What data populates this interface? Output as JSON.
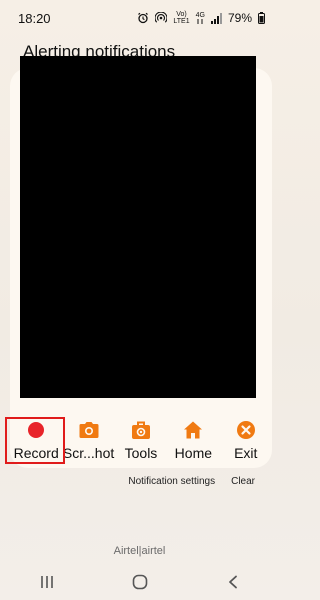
{
  "status_bar": {
    "time": "18:20",
    "network_label_top": "Vo)",
    "network_label_mid": "LTE1",
    "network_type": "4G",
    "battery": "79%"
  },
  "heading": "Alerting notifications",
  "actions": [
    {
      "label": "Record",
      "icon": "record-dot-icon"
    },
    {
      "label": "Scr...hot",
      "icon": "camera-icon"
    },
    {
      "label": "Tools",
      "icon": "toolbox-icon"
    },
    {
      "label": "Home",
      "icon": "home-icon"
    },
    {
      "label": "Exit",
      "icon": "close-circle-icon"
    }
  ],
  "notification_links": {
    "settings": "Notification settings",
    "clear": "Clear"
  },
  "carrier": "Airtel|airtel",
  "nav": {
    "recents": "recents-icon",
    "home": "home-circle-icon",
    "back": "back-icon"
  },
  "colors": {
    "accent_orange": "#f07a12",
    "record_red": "#e8242a",
    "highlight_red": "#e01b1b"
  }
}
